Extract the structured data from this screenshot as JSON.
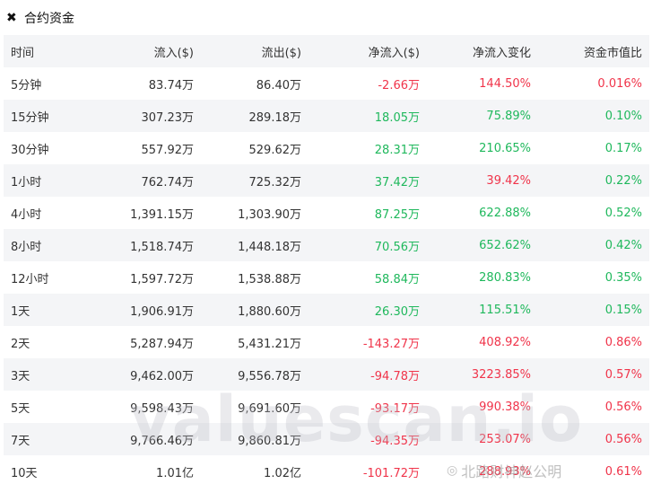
{
  "header": {
    "icon": "close-x-icon",
    "title": "合约资金"
  },
  "table": {
    "columns": [
      "时间",
      "流入($)",
      "流出($)",
      "净流入($)",
      "净流入变化",
      "资金市值比"
    ],
    "rows": [
      {
        "time": "5分钟",
        "inflow": "83.74万",
        "outflow": "86.40万",
        "net": "-2.66万",
        "net_dir": "neg",
        "change": "144.50%",
        "change_dir": "neg",
        "ratio": "0.016%",
        "ratio_dir": "neg"
      },
      {
        "time": "15分钟",
        "inflow": "307.23万",
        "outflow": "289.18万",
        "net": "18.05万",
        "net_dir": "pos",
        "change": "75.89%",
        "change_dir": "pos",
        "ratio": "0.10%",
        "ratio_dir": "pos"
      },
      {
        "time": "30分钟",
        "inflow": "557.92万",
        "outflow": "529.62万",
        "net": "28.31万",
        "net_dir": "pos",
        "change": "210.65%",
        "change_dir": "pos",
        "ratio": "0.17%",
        "ratio_dir": "pos"
      },
      {
        "time": "1小时",
        "inflow": "762.74万",
        "outflow": "725.32万",
        "net": "37.42万",
        "net_dir": "pos",
        "change": "39.42%",
        "change_dir": "neg",
        "ratio": "0.22%",
        "ratio_dir": "pos"
      },
      {
        "time": "4小时",
        "inflow": "1,391.15万",
        "outflow": "1,303.90万",
        "net": "87.25万",
        "net_dir": "pos",
        "change": "622.88%",
        "change_dir": "pos",
        "ratio": "0.52%",
        "ratio_dir": "pos"
      },
      {
        "time": "8小时",
        "inflow": "1,518.74万",
        "outflow": "1,448.18万",
        "net": "70.56万",
        "net_dir": "pos",
        "change": "652.62%",
        "change_dir": "pos",
        "ratio": "0.42%",
        "ratio_dir": "pos"
      },
      {
        "time": "12小时",
        "inflow": "1,597.72万",
        "outflow": "1,538.88万",
        "net": "58.84万",
        "net_dir": "pos",
        "change": "280.83%",
        "change_dir": "pos",
        "ratio": "0.35%",
        "ratio_dir": "pos"
      },
      {
        "time": "1天",
        "inflow": "1,906.91万",
        "outflow": "1,880.60万",
        "net": "26.30万",
        "net_dir": "pos",
        "change": "115.51%",
        "change_dir": "pos",
        "ratio": "0.15%",
        "ratio_dir": "pos"
      },
      {
        "time": "2天",
        "inflow": "5,287.94万",
        "outflow": "5,431.21万",
        "net": "-143.27万",
        "net_dir": "neg",
        "change": "408.92%",
        "change_dir": "neg",
        "ratio": "0.86%",
        "ratio_dir": "neg"
      },
      {
        "time": "3天",
        "inflow": "9,462.00万",
        "outflow": "9,556.78万",
        "net": "-94.78万",
        "net_dir": "neg",
        "change": "3223.85%",
        "change_dir": "neg",
        "ratio": "0.57%",
        "ratio_dir": "neg"
      },
      {
        "time": "5天",
        "inflow": "9,598.43万",
        "outflow": "9,691.60万",
        "net": "-93.17万",
        "net_dir": "neg",
        "change": "990.38%",
        "change_dir": "neg",
        "ratio": "0.56%",
        "ratio_dir": "neg"
      },
      {
        "time": "7天",
        "inflow": "9,766.46万",
        "outflow": "9,860.81万",
        "net": "-94.35万",
        "net_dir": "neg",
        "change": "253.07%",
        "change_dir": "neg",
        "ratio": "0.56%",
        "ratio_dir": "neg"
      },
      {
        "time": "10天",
        "inflow": "1.01亿",
        "outflow": "1.02亿",
        "net": "-101.72万",
        "net_dir": "neg",
        "change": "288.93%",
        "change_dir": "neg",
        "ratio": "0.61%",
        "ratio_dir": "neg"
      }
    ]
  },
  "colors": {
    "positive": "#1fb85c",
    "negative": "#f0344a",
    "stripe": "#f4f5f7"
  },
  "watermark": "valuescan.io",
  "credit": {
    "icon": "wechat-icon",
    "text": "北路财神赵公明"
  }
}
